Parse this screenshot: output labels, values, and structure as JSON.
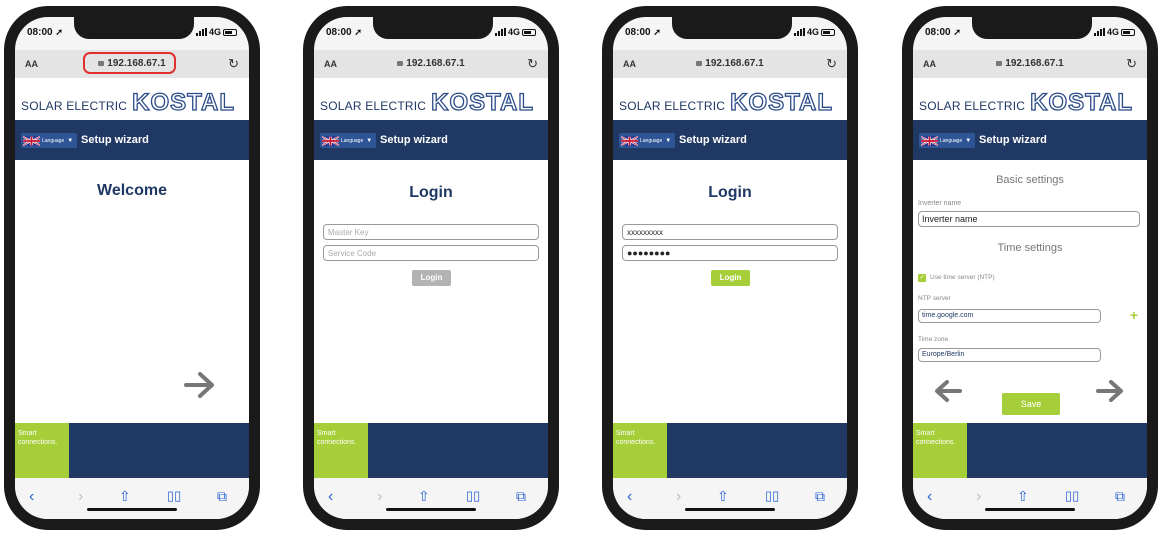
{
  "phones": [
    {
      "status": {
        "time": "08:00",
        "network": "4G"
      },
      "browser": {
        "text_size": "AA",
        "url": "192.168.67.1"
      },
      "brand": {
        "small": "SOLAR ELECTRIC",
        "big": "KOSTAL"
      },
      "nav": {
        "language": "Language",
        "title": "Setup wizard"
      },
      "footer": {
        "slogan": "Smart connections."
      },
      "welcome": {
        "title": "Welcome"
      }
    },
    {
      "status": {
        "time": "08:00",
        "network": "4G"
      },
      "browser": {
        "text_size": "AA",
        "url": "192.168.67.1"
      },
      "brand": {
        "small": "SOLAR ELECTRIC",
        "big": "KOSTAL"
      },
      "nav": {
        "language": "Language",
        "title": "Setup wizard"
      },
      "footer": {
        "slogan": "Smart connections."
      },
      "login": {
        "title": "Login",
        "master_key_placeholder": "Master Key",
        "service_code_placeholder": "Service Code",
        "button": "Login"
      }
    },
    {
      "status": {
        "time": "08:00",
        "network": "4G"
      },
      "browser": {
        "text_size": "AA",
        "url": "192.168.67.1"
      },
      "brand": {
        "small": "SOLAR ELECTRIC",
        "big": "KOSTAL"
      },
      "nav": {
        "language": "Language",
        "title": "Setup wizard"
      },
      "footer": {
        "slogan": "Smart connections."
      },
      "login": {
        "title": "Login",
        "master_key_value": "xxxxxxxxx",
        "service_code_value": "●●●●●●●●",
        "button": "Login"
      }
    },
    {
      "status": {
        "time": "08:00",
        "network": "4G"
      },
      "browser": {
        "text_size": "AA",
        "url": "192.168.67.1"
      },
      "brand": {
        "small": "SOLAR ELECTRIC",
        "big": "KOSTAL"
      },
      "nav": {
        "language": "Language",
        "title": "Setup wizard"
      },
      "footer": {
        "slogan": "Smart connections."
      },
      "settings": {
        "basic_heading": "Basic settings",
        "inverter_name_label": "Inverter name",
        "inverter_name_value": "Inverter name",
        "time_heading": "Time settings",
        "ntp_checkbox_label": "Use time server (NTP)",
        "ntp_server_label": "NTP server",
        "ntp_server_value": "time.google.com",
        "time_zone_label": "Time zone",
        "time_zone_value": "Europe/Berlin",
        "save_button": "Save"
      }
    }
  ],
  "colors": {
    "navy": "#203864",
    "green": "#a6ce39",
    "link_blue": "#2a62d3",
    "highlight_red": "#e03030"
  }
}
